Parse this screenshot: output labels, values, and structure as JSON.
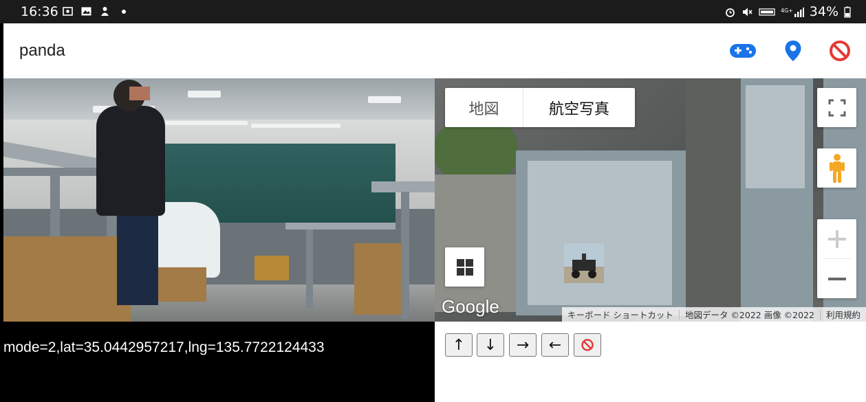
{
  "status_bar": {
    "time": "16:36",
    "battery": "34%"
  },
  "app": {
    "title": "panda"
  },
  "colors": {
    "accent_blue": "#1a73e8",
    "stop_red": "#e53935",
    "pegman": "#f5a623"
  },
  "icons": {
    "gamepad": "gamepad-icon",
    "location": "location-pin-icon",
    "stop": "no-entry-icon"
  },
  "map": {
    "type_map": "地図",
    "type_satellite": "航空写真",
    "logo": "Google",
    "footer": {
      "shortcuts": "キーボード ショートカット",
      "data": "地図データ ©2022 画像 ©2022",
      "terms": "利用規約"
    }
  },
  "info_text": "mode=2,lat=35.0442957217,lng=135.7722124433",
  "controls": {
    "up": "↑",
    "down": "↓",
    "right": "→",
    "left": "←"
  }
}
